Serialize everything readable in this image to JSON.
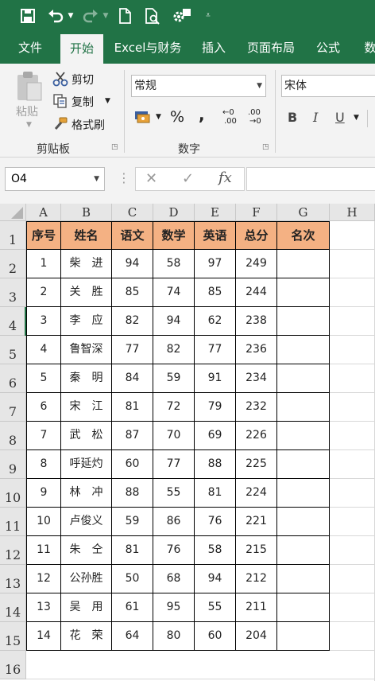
{
  "ribbon_tabs": [
    {
      "label": "文件",
      "active": false
    },
    {
      "label": "开始",
      "active": true
    },
    {
      "label": "Excel与财务",
      "active": false
    },
    {
      "label": "插入",
      "active": false
    },
    {
      "label": "页面布局",
      "active": false
    },
    {
      "label": "公式",
      "active": false
    },
    {
      "label": "数",
      "active": false
    }
  ],
  "clipboard": {
    "paste_label": "粘贴",
    "cut_label": "剪切",
    "copy_label": "复制",
    "format_painter_label": "格式刷",
    "group_label": "剪贴板"
  },
  "number": {
    "format_value": "常规",
    "percent_symbol": "%",
    "comma_symbol": ",",
    "increase_decimal_top": "←0",
    "increase_decimal_bottom": ".00",
    "decrease_decimal_top": ".00",
    "decrease_decimal_bottom": "→0",
    "group_label": "数字"
  },
  "font": {
    "font_name": "宋体",
    "bold_label": "B",
    "italic_label": "I",
    "underline_label": "U"
  },
  "formula_bar": {
    "name_box": "O4",
    "cancel_symbol": "✕",
    "enter_symbol": "✓",
    "fx_label": "fx",
    "formula": ""
  },
  "sheet": {
    "column_headers": [
      "A",
      "B",
      "C",
      "D",
      "E",
      "F",
      "G",
      "H"
    ],
    "row_numbers": [
      "1",
      "2",
      "3",
      "4",
      "5",
      "6",
      "7",
      "8",
      "9",
      "10",
      "11",
      "12",
      "13",
      "14",
      "15",
      "16"
    ],
    "table_headers": [
      "序号",
      "姓名",
      "语文",
      "数学",
      "英语",
      "总分",
      "名次"
    ],
    "rows": [
      [
        "1",
        "柴　进",
        "94",
        "58",
        "97",
        "249",
        ""
      ],
      [
        "2",
        "关　胜",
        "85",
        "74",
        "85",
        "244",
        ""
      ],
      [
        "3",
        "李　应",
        "82",
        "94",
        "62",
        "238",
        ""
      ],
      [
        "4",
        "鲁智深",
        "77",
        "82",
        "77",
        "236",
        ""
      ],
      [
        "5",
        "秦　明",
        "84",
        "59",
        "91",
        "234",
        ""
      ],
      [
        "6",
        "宋　江",
        "81",
        "72",
        "79",
        "232",
        ""
      ],
      [
        "7",
        "武　松",
        "87",
        "70",
        "69",
        "226",
        ""
      ],
      [
        "8",
        "呼延灼",
        "60",
        "77",
        "88",
        "225",
        ""
      ],
      [
        "9",
        "林　冲",
        "88",
        "55",
        "81",
        "224",
        ""
      ],
      [
        "10",
        "卢俊义",
        "59",
        "86",
        "76",
        "221",
        ""
      ],
      [
        "11",
        "朱　仝",
        "81",
        "76",
        "58",
        "215",
        ""
      ],
      [
        "12",
        "公孙胜",
        "50",
        "68",
        "94",
        "212",
        ""
      ],
      [
        "13",
        "吴　用",
        "61",
        "95",
        "55",
        "211",
        ""
      ],
      [
        "14",
        "花　荣",
        "64",
        "80",
        "60",
        "204",
        ""
      ]
    ],
    "header_fill": "#f4b183"
  },
  "colors": {
    "brand": "#217346",
    "ribbon_bg": "#f3f3f3",
    "header_bg": "#e6e6e6"
  }
}
